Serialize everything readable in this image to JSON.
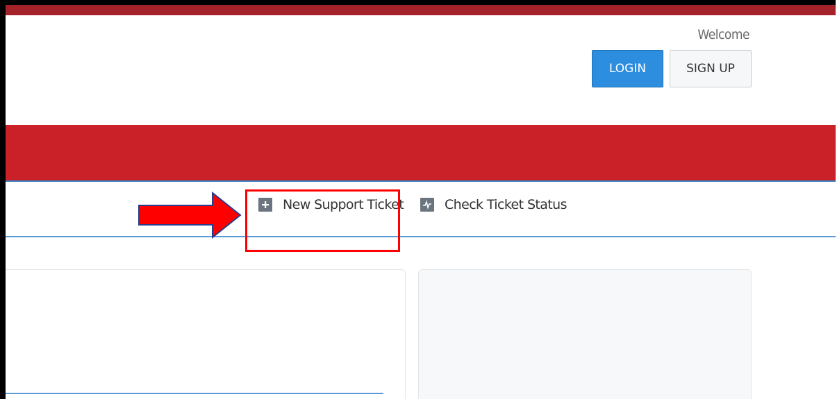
{
  "header": {
    "welcome": "Welcome",
    "login_label": "LOGIN",
    "signup_label": "SIGN UP"
  },
  "nav": {
    "items": [
      {
        "label": "New Support Ticket",
        "icon": "plus-icon"
      },
      {
        "label": "Check Ticket Status",
        "icon": "activity-icon"
      }
    ]
  },
  "colors": {
    "brand_red": "#c92127",
    "top_bar": "#a6222a",
    "login_blue": "#2d8ee0",
    "annotation_red": "#ff0000"
  }
}
